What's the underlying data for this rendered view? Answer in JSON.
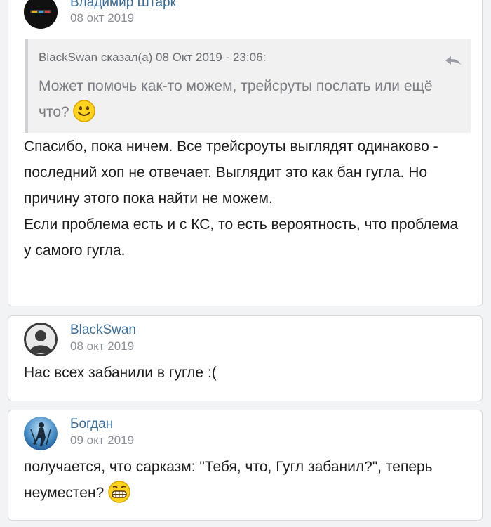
{
  "comments": [
    {
      "author": "Владимир Штарк",
      "date": "08 окт 2019",
      "avatar_icon": "black-logo-avatar",
      "quote": {
        "header": "BlackSwan сказал(а) 08 Окт 2019 - 23:06:",
        "text": "Может помочь как-то можем, трейсруты послать или ещё что?",
        "emoji": "smile-emoji-icon"
      },
      "paragraphs": [
        "Спасибо, пока ничем. Все трейсроуты выглядят одинаково - последний хоп не отвечает. Выглядит это как бан гугла. Но причину этого пока найти не можем.",
        "Если проблема есть и с КС, то есть вероятность, что проблема у самого гугла."
      ]
    },
    {
      "author": "BlackSwan",
      "date": "08 окт 2019",
      "avatar_icon": "default-user-avatar",
      "text": "Нас всех забанили в гугле :("
    },
    {
      "author": "Богдан",
      "date": "09 окт 2019",
      "avatar_icon": "skier-photo-avatar",
      "text": "получается, что сарказм: \"Тебя, что, Гугл забанил?\", теперь неуместен?",
      "emoji": "grin-emoji-icon"
    }
  ],
  "colors": {
    "author": "#3d6d94",
    "date": "#8a8f96",
    "page_bg": "#f2f3f5"
  }
}
